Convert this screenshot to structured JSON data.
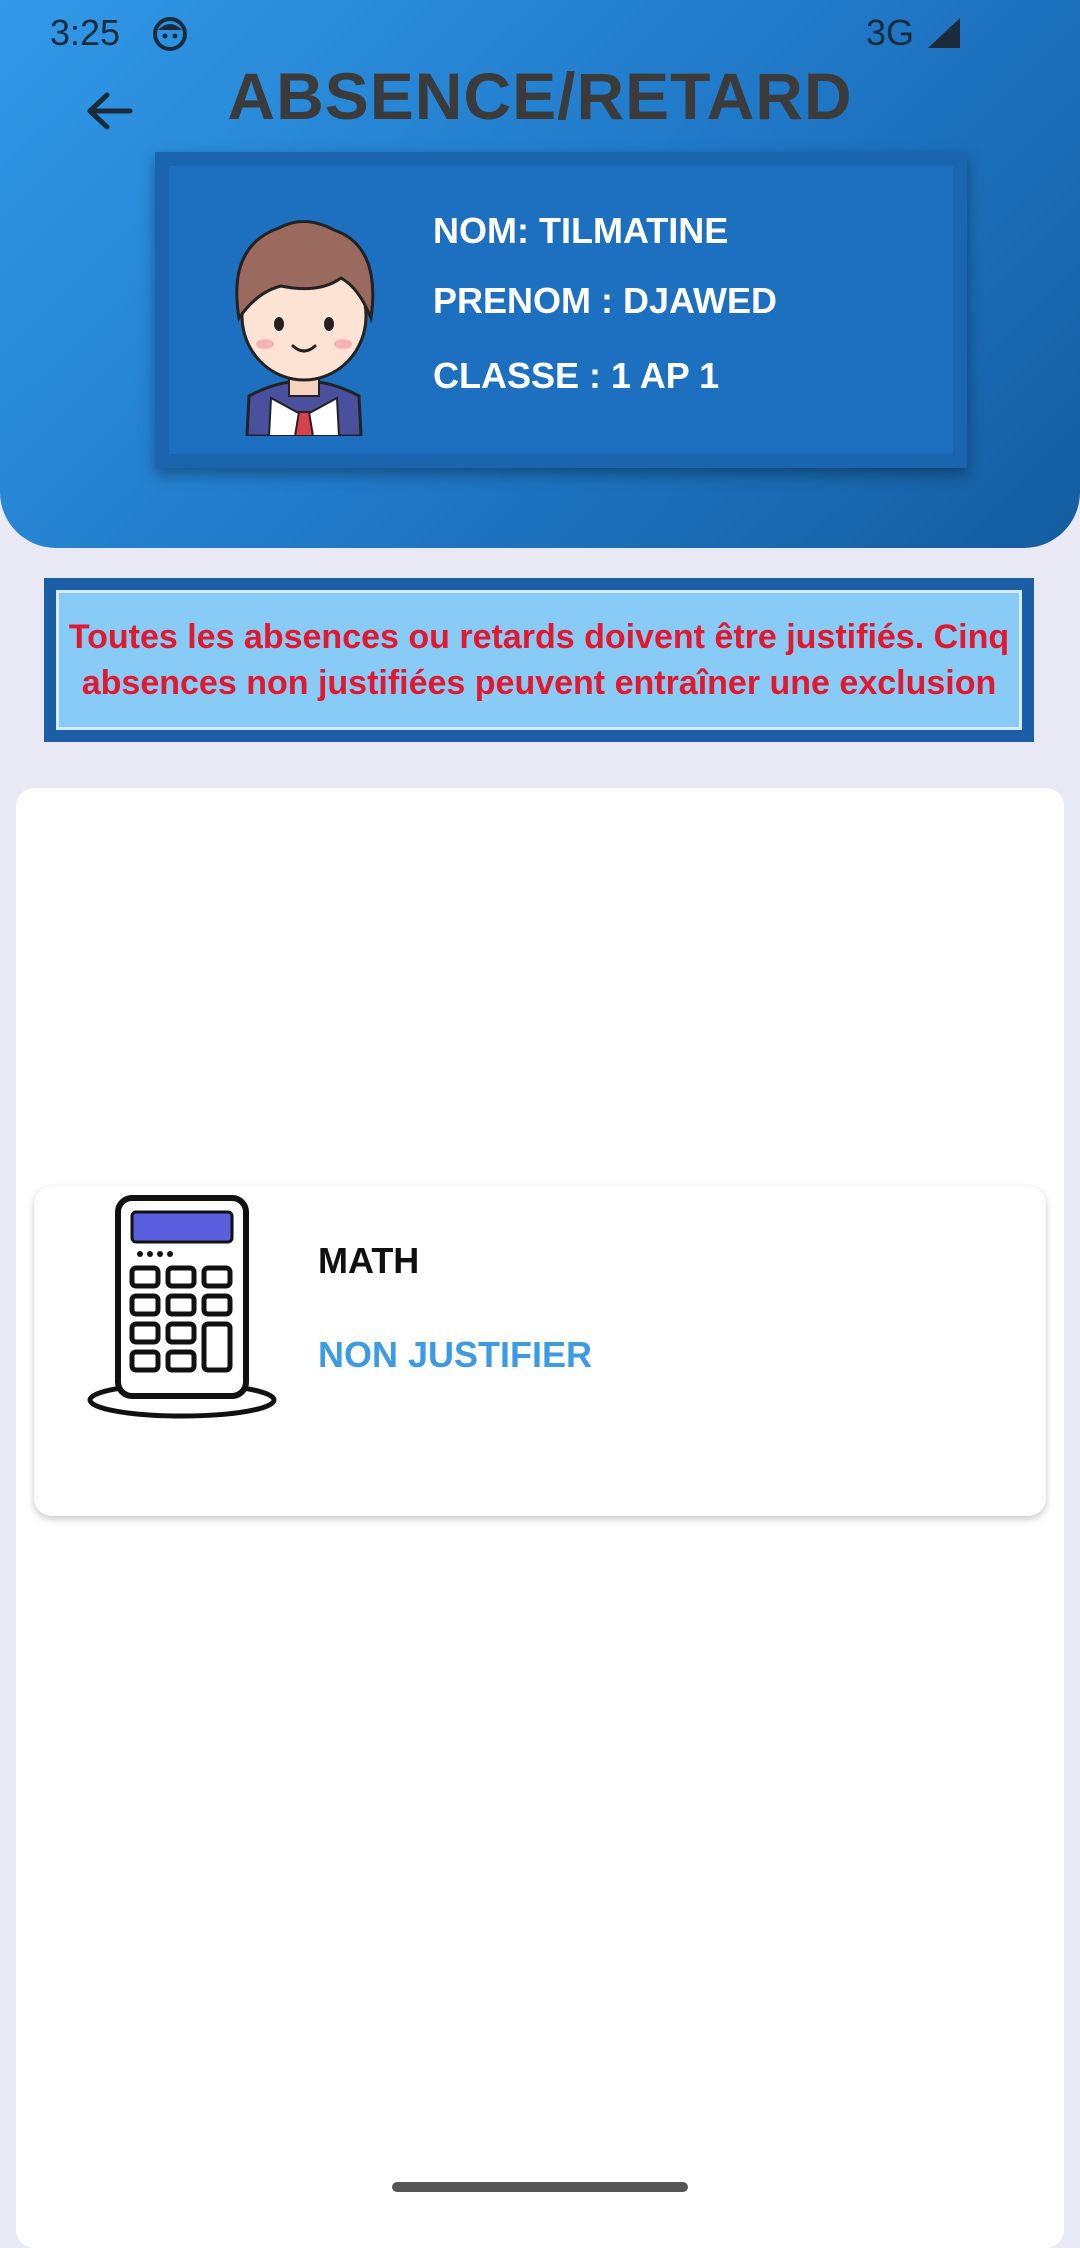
{
  "status_bar": {
    "time": "3:25",
    "network": "3G"
  },
  "header": {
    "title": "ABSENCE/RETARD"
  },
  "profile": {
    "nom": "NOM: TILMATINE",
    "prenom": "PRENOM : DJAWED",
    "classe": "CLASSE : 1 AP 1"
  },
  "notice": {
    "text": "Toutes les absences ou retards doivent être justifiés. Cinq absences non justifiées peuvent entraîner une exclusion"
  },
  "absences": [
    {
      "subject": "MATH",
      "status": "NON JUSTIFIER",
      "icon": "calculator-icon"
    }
  ],
  "colors": {
    "header_gradient_start": "#3199e8",
    "header_gradient_end": "#145da0",
    "notice_text": "#e3172e",
    "notice_bg": "#87cbf6",
    "status_accent": "#3d9be3"
  }
}
